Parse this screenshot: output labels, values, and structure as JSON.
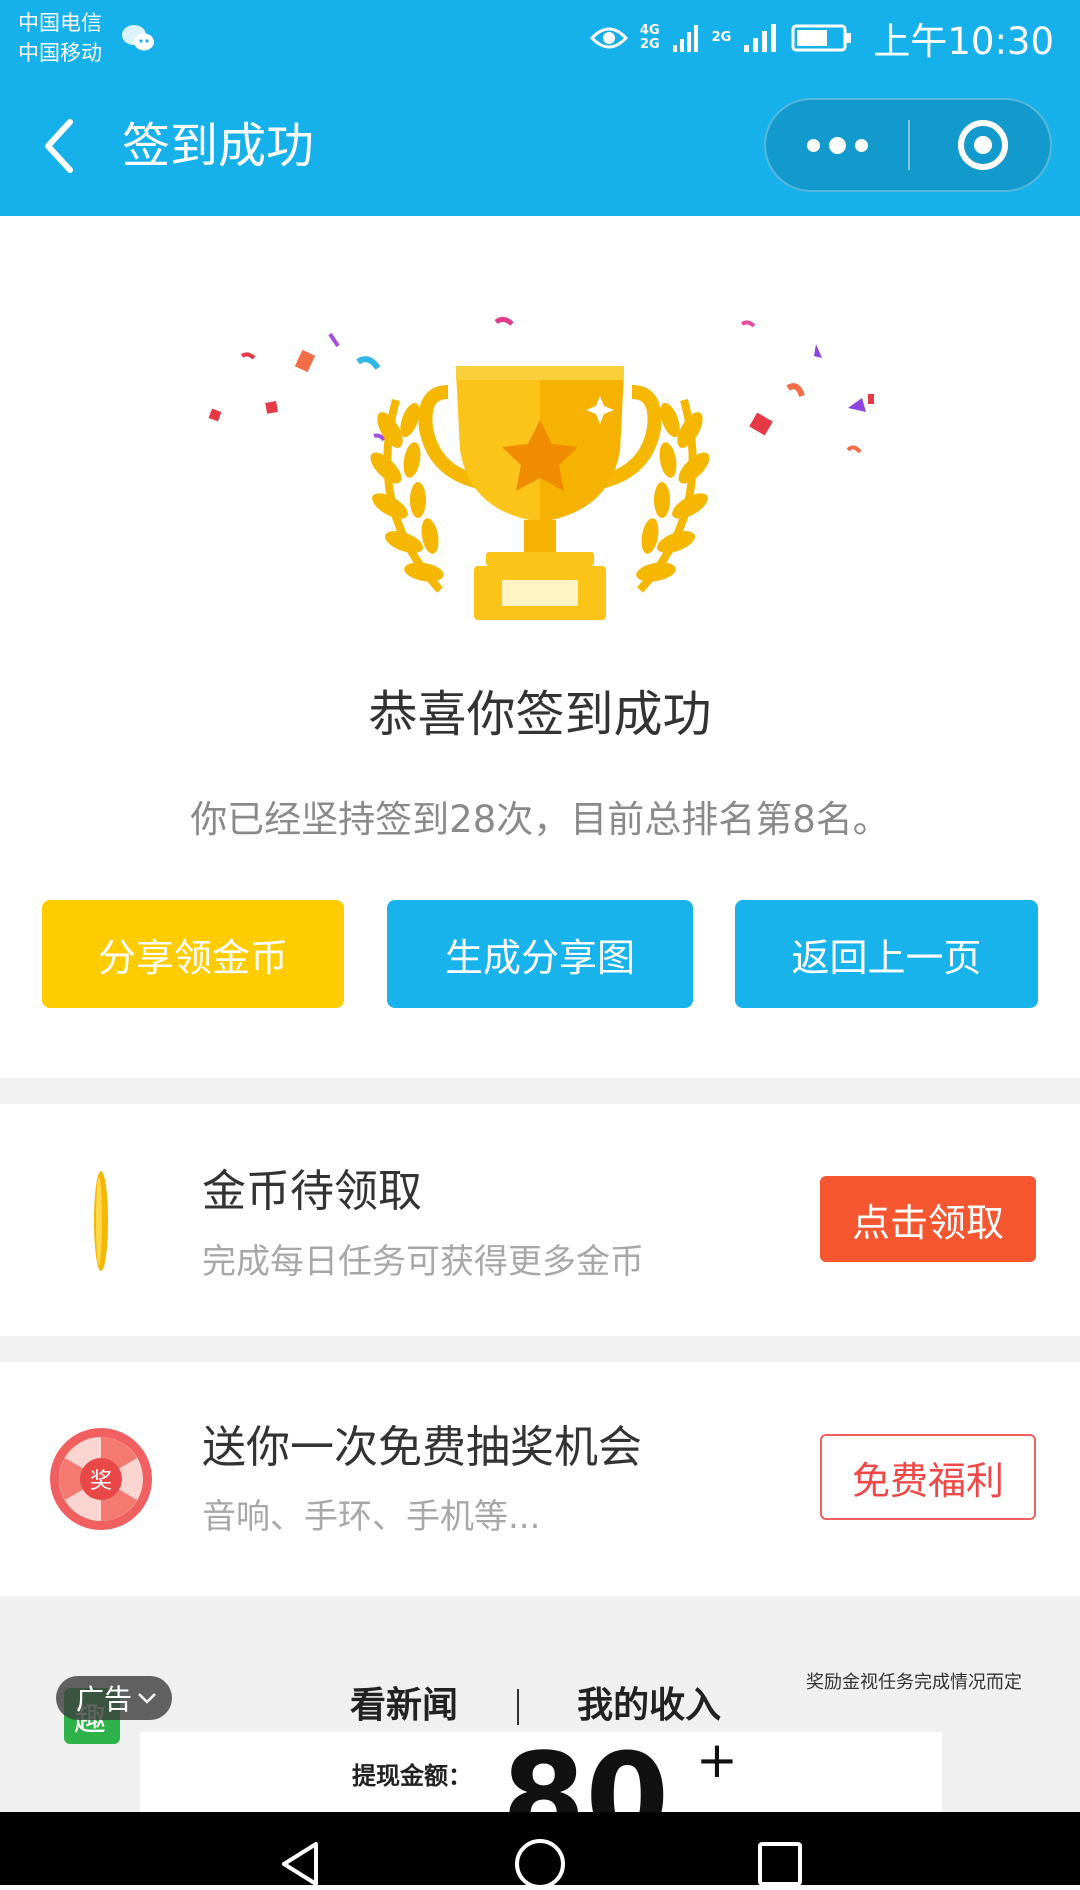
{
  "status_bar": {
    "carrier_1": "中国电信",
    "carrier_2": "中国移动",
    "network_1_top": "4G",
    "network_1_bottom": "2G",
    "network_2": "2G",
    "time": "上午10:30"
  },
  "nav": {
    "title": "签到成功"
  },
  "hero": {
    "congrats": "恭喜你签到成功",
    "stats": "你已经坚持签到28次，目前总排名第8名。"
  },
  "actions": {
    "share_coins": "分享领金币",
    "make_image": "生成分享图",
    "go_back": "返回上一页"
  },
  "coins_row": {
    "title": "金币待领取",
    "subtitle": "完成每日任务可获得更多金币",
    "button": "点击领取"
  },
  "lottery_row": {
    "icon_text": "奖",
    "title": "送你一次免费抽奖机会",
    "subtitle": "音响、手环、手机等...",
    "button": "免费福利"
  },
  "ad": {
    "badge": "广告",
    "logo_text": "趣",
    "tab_news": "看新闻",
    "tab_income": "我的收入",
    "note": "奖励金视任务完成情况而定",
    "amount_label": "提现金额：",
    "amount": "80",
    "plus": "+"
  },
  "colors": {
    "brand_blue": "#16b0ea",
    "share_yellow": "#ffcc00",
    "claim_orange": "#f55630",
    "welfare_red": "#f04848"
  }
}
